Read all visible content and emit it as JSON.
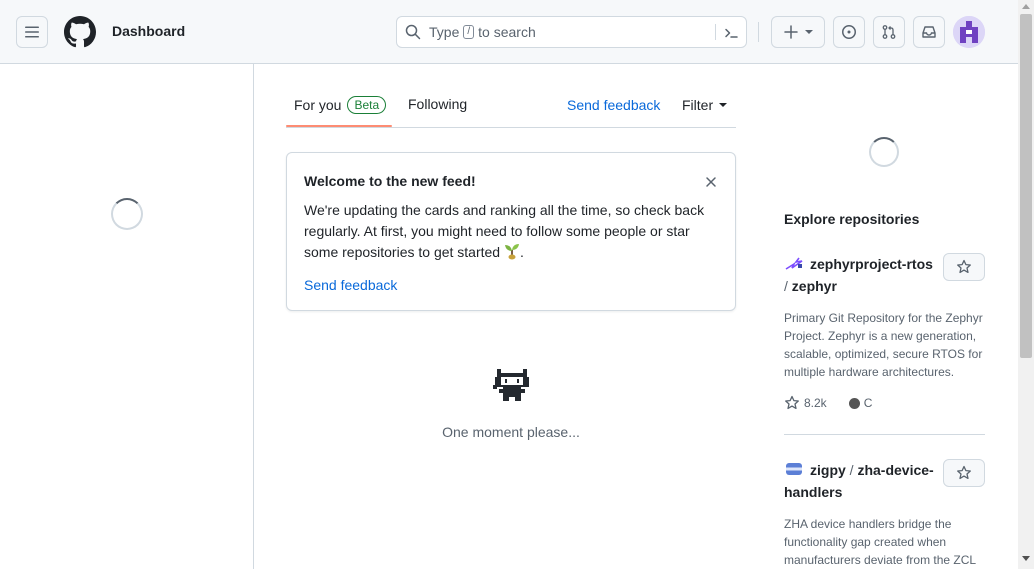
{
  "header": {
    "title": "Dashboard",
    "search": {
      "prefix": "Type",
      "key": "/",
      "suffix": "to search"
    },
    "icons": [
      "hamburger-icon",
      "github-logo-icon",
      "search-icon",
      "command-palette-icon",
      "plus-icon",
      "issues-icon",
      "pull-requests-icon",
      "inbox-icon",
      "avatar"
    ]
  },
  "feed": {
    "tabs": [
      {
        "label": "For you",
        "badge": "Beta",
        "active": true
      },
      {
        "label": "Following",
        "active": false
      }
    ],
    "send_feedback": "Send feedback",
    "filter": "Filter"
  },
  "welcome_card": {
    "title": "Welcome to the new feed!",
    "body": "We're updating the cards and ranking all the time, so check back regularly. At first, you might need to follow some people or star some repositories to get started",
    "body_end": ".",
    "link": "Send feedback"
  },
  "loading": {
    "text": "One moment please..."
  },
  "explore": {
    "title": "Explore repositories",
    "repos": [
      {
        "owner": "zephyrproject-rtos",
        "name": "zephyr",
        "description": "Primary Git Repository for the Zephyr Project. Zephyr is a new generation, scalable, optimized, secure RTOS for multiple hardware architectures.",
        "stars": "8.2k",
        "language": "C",
        "language_color": "#555555"
      },
      {
        "owner": "zigpy",
        "name": "zha-device-handlers",
        "description": "ZHA device handlers bridge the functionality gap created when manufacturers deviate from the ZCL"
      }
    ]
  },
  "colors": {
    "link": "#0969da",
    "tab_underline": "#fd8c73",
    "beta_badge": "#1a7f37",
    "header_bg": "#f6f8fa",
    "border": "#d1d9e0"
  }
}
